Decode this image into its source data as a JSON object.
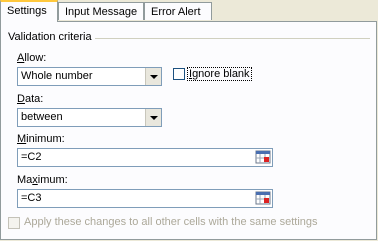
{
  "tabs": [
    {
      "label": "Settings",
      "active": true
    },
    {
      "label": "Input Message",
      "active": false
    },
    {
      "label": "Error Alert",
      "active": false
    }
  ],
  "group": {
    "title": "Validation criteria"
  },
  "allow": {
    "label_prefix": "",
    "label_mnemonic": "A",
    "label_rest": "llow:",
    "value": "Whole number"
  },
  "ignore_blank": {
    "mnemonic": "I",
    "rest": "gnore blank",
    "checked": false
  },
  "data": {
    "label_mnemonic": "D",
    "label_rest": "ata:",
    "value": "between"
  },
  "minimum": {
    "label_mnemonic": "M",
    "label_rest": "inimum:",
    "value": "=C2"
  },
  "maximum": {
    "label_prefix": "Ma",
    "label_mnemonic": "x",
    "label_rest": "imum:",
    "value": "=C3"
  },
  "apply_all": {
    "label": "Apply these changes to all other cells with the same settings",
    "checked": false,
    "enabled": false
  },
  "icons": {
    "combo_arrow": "chevron-down-icon",
    "range_picker": "collapse-dialog-icon"
  }
}
